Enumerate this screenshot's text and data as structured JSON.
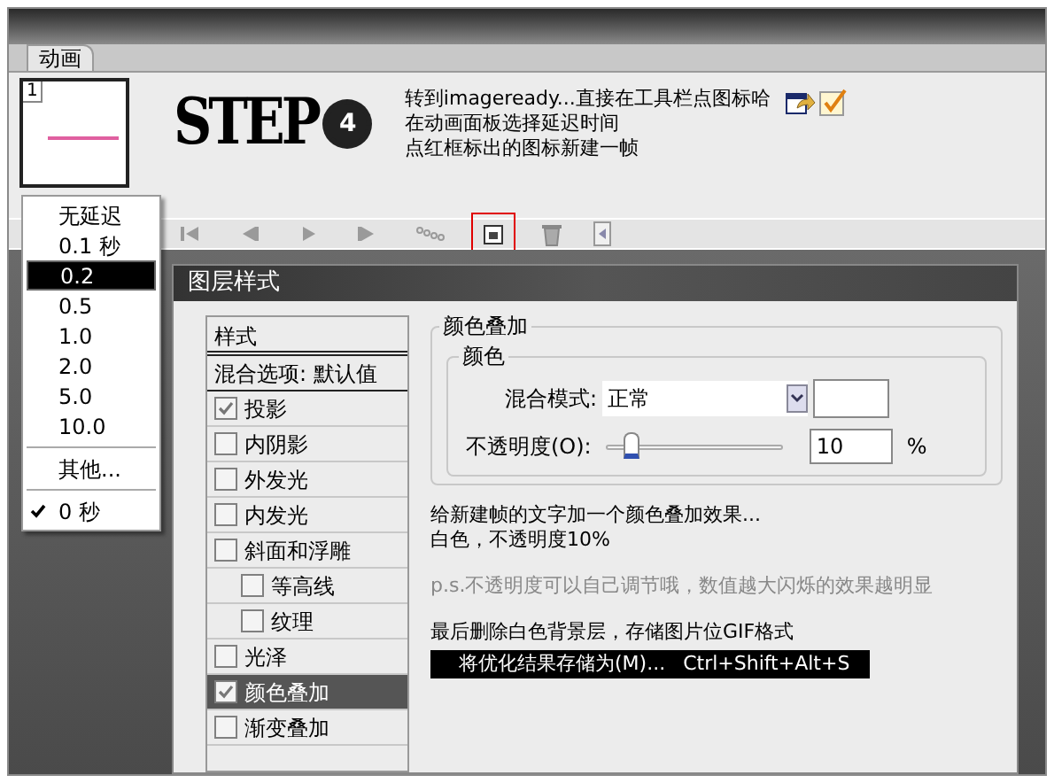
{
  "panel": {
    "tab": "动画",
    "frame": {
      "number": "1"
    }
  },
  "step": {
    "label": "STEP",
    "number": "4"
  },
  "instructions": [
    "转到imageready...直接在工具栏点图标哈",
    "在动画面板选择延迟时间",
    "点红框标出的图标新建一帧"
  ],
  "toolbar": [
    {
      "kind": "first",
      "highlighted": false
    },
    {
      "kind": "prev",
      "highlighted": false
    },
    {
      "kind": "play",
      "highlighted": false
    },
    {
      "kind": "next",
      "highlighted": false
    },
    {
      "kind": "tween",
      "highlighted": false
    },
    {
      "kind": "new",
      "highlighted": true
    },
    {
      "kind": "delete",
      "highlighted": false
    }
  ],
  "delay_menu": [
    [
      {
        "label": "无延迟",
        "selected": false,
        "checked": false
      },
      {
        "label": "0.1 秒",
        "selected": false,
        "checked": false
      },
      {
        "label": "0.2",
        "selected": true,
        "checked": false
      },
      {
        "label": "0.5",
        "selected": false,
        "checked": false
      },
      {
        "label": "1.0",
        "selected": false,
        "checked": false
      },
      {
        "label": "2.0",
        "selected": false,
        "checked": false
      },
      {
        "label": "5.0",
        "selected": false,
        "checked": false
      },
      {
        "label": "10.0",
        "selected": false,
        "checked": false
      }
    ],
    [
      {
        "label": "其他...",
        "selected": false,
        "checked": false
      }
    ],
    [
      {
        "label": "0 秒",
        "selected": false,
        "checked": true
      }
    ]
  ],
  "dialog": {
    "title": "图层样式",
    "styles_header": "样式",
    "blend_options": "混合选项: 默认值",
    "styles": [
      {
        "label": "投影",
        "checked": true,
        "selected": false
      },
      {
        "label": "内阴影",
        "checked": false,
        "selected": false
      },
      {
        "label": "外发光",
        "checked": false,
        "selected": false
      },
      {
        "label": "内发光",
        "checked": false,
        "selected": false
      },
      {
        "label": "斜面和浮雕",
        "checked": false,
        "selected": false,
        "children": [
          {
            "label": "等高线",
            "checked": false,
            "selected": false
          },
          {
            "label": "纹理",
            "checked": false,
            "selected": false
          }
        ]
      },
      {
        "label": "光泽",
        "checked": false,
        "selected": false
      },
      {
        "label": "颜色叠加",
        "checked": true,
        "selected": true
      },
      {
        "label": "渐变叠加",
        "checked": false,
        "selected": false
      }
    ],
    "section_title": "颜色叠加",
    "group_title": "颜色",
    "blend_mode": {
      "label": "混合模式:",
      "value": "正常",
      "color": "#ffffff"
    },
    "opacity": {
      "label": "不透明度(O):",
      "level": 0.1,
      "value": "10",
      "unit": "%"
    },
    "notes": [
      "给新建帧的文字加一个颜色叠加效果...",
      "白色，不透明度10%"
    ],
    "ps": "p.s.不透明度可以自己调节哦，数值越大闪烁的效果越明显",
    "final": "最后删除白色背景层，存储图片位GIF格式",
    "menu_item": {
      "label": "将优化结果存储为(M)...",
      "shortcut": "Ctrl+Shift+Alt+S"
    }
  }
}
